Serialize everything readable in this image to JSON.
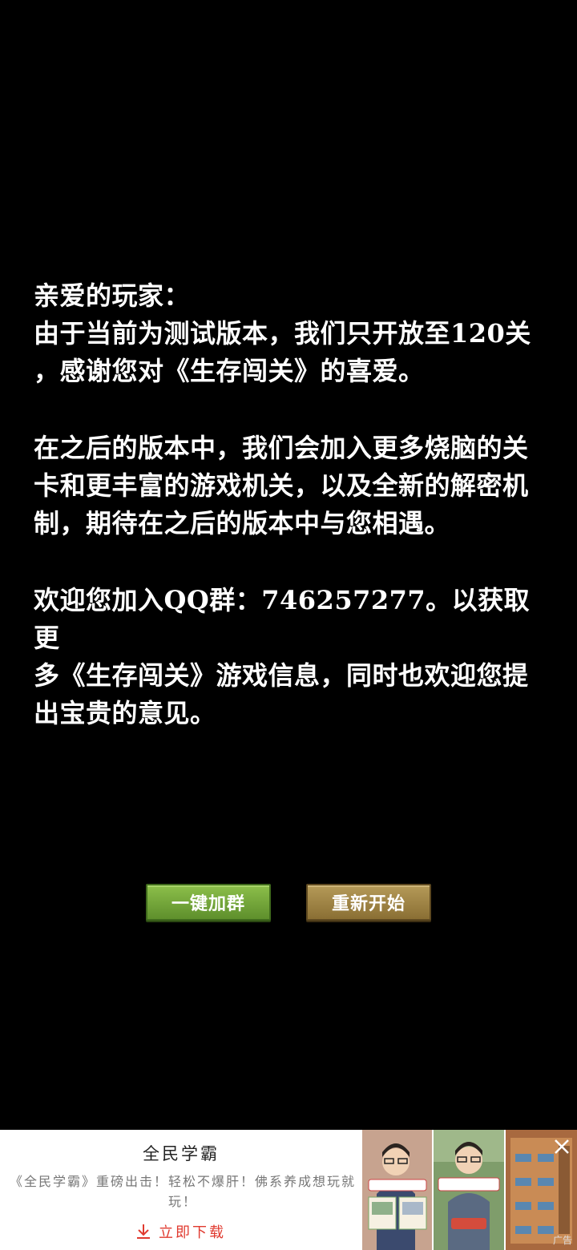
{
  "letter": {
    "greeting": "亲爱的玩家：",
    "paragraph1": "由于当前为测试版本，我们只开放至120关\n，感谢您对《生存闯关》的喜爱。",
    "paragraph2": "在之后的版本中，我们会加入更多烧脑的关\n卡和更丰富的游戏机关，以及全新的解密机\n制，期待在之后的版本中与您相遇。",
    "paragraph3": "欢迎您加入QQ群：746257277。以获取更\n多《生存闯关》游戏信息，同时也欢迎您提\n出宝贵的意见。"
  },
  "buttons": {
    "join_group": "一键加群",
    "restart": "重新开始"
  },
  "ad": {
    "title": "全民学霸",
    "description": "《全民学霸》重磅出击！轻松不爆肝！佛系养成想玩就玩！",
    "download_label": "立即下载",
    "ad_mark": "广告",
    "download_icon": "download-arrow-icon",
    "close_icon": "close-icon"
  },
  "colors": {
    "background": "#000000",
    "text": "#ffffff",
    "join_button": "#6f9f38",
    "restart_button": "#a0864a",
    "download_accent": "#e03a2f"
  }
}
